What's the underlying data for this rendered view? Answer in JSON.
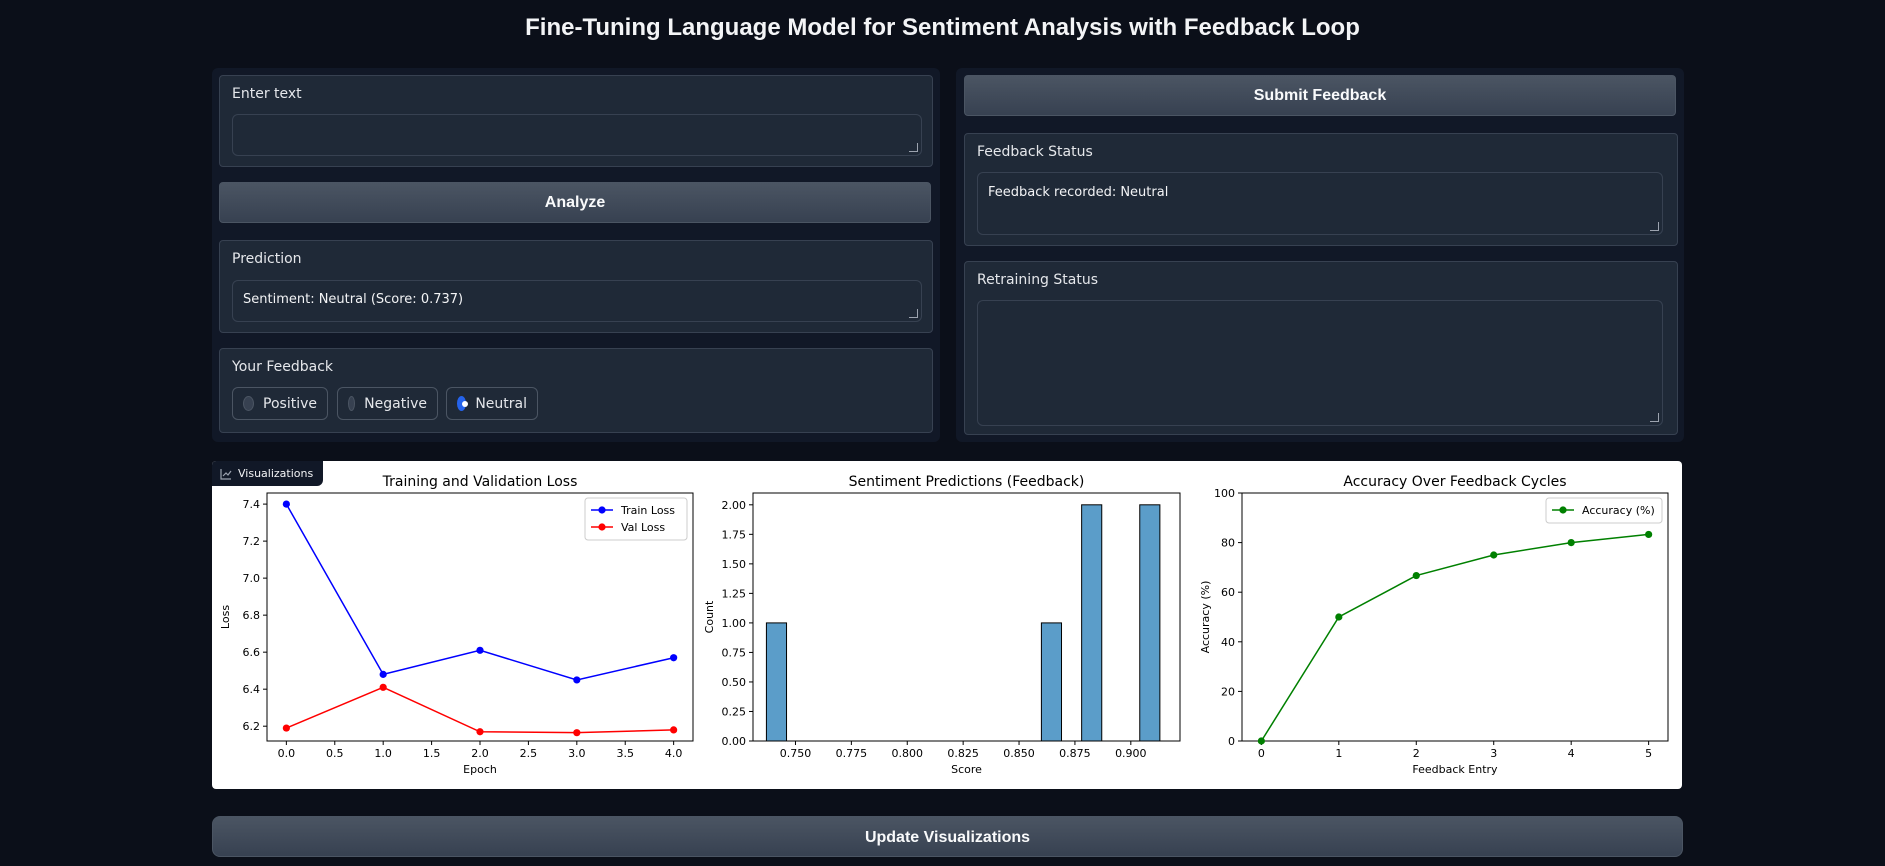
{
  "app": {
    "title": "Fine-Tuning Language Model for Sentiment Analysis with Feedback Loop"
  },
  "left": {
    "input_label": "Enter text",
    "input_value": "",
    "analyze_label": "Analyze",
    "prediction_label": "Prediction",
    "prediction_value": "Sentiment: Neutral (Score: 0.737)",
    "feedback_label": "Your Feedback",
    "feedback_options": [
      "Positive",
      "Negative",
      "Neutral"
    ],
    "feedback_selected": "Neutral"
  },
  "right": {
    "submit_label": "Submit Feedback",
    "feedback_status_label": "Feedback Status",
    "feedback_status_value": "Feedback recorded: Neutral",
    "retraining_status_label": "Retraining Status",
    "retraining_status_value": ""
  },
  "visualizations": {
    "tag_label": "Visualizations",
    "tag_icon": "chart-icon",
    "update_label": "Update Visualizations"
  },
  "chart_data": [
    {
      "type": "line",
      "title": "Training and Validation Loss",
      "xlabel": "Epoch",
      "ylabel": "Loss",
      "x": [
        0,
        1,
        2,
        3,
        4
      ],
      "xlim": [
        -0.2,
        4.2
      ],
      "ylim": [
        6.12,
        7.46
      ],
      "xticks": [
        "0.0",
        "0.5",
        "1.0",
        "1.5",
        "2.0",
        "2.5",
        "3.0",
        "3.5",
        "4.0"
      ],
      "yticks": [
        "6.2",
        "6.4",
        "6.6",
        "6.8",
        "7.0",
        "7.2",
        "7.4"
      ],
      "legend": "top-right",
      "series": [
        {
          "name": "Train Loss",
          "color": "#0000ff",
          "values": [
            7.4,
            6.48,
            6.61,
            6.45,
            6.57
          ]
        },
        {
          "name": "Val Loss",
          "color": "#ff0000",
          "values": [
            6.19,
            6.41,
            6.17,
            6.165,
            6.18
          ]
        }
      ]
    },
    {
      "type": "bar",
      "title": "Sentiment Predictions (Feedback)",
      "xlabel": "Score",
      "ylabel": "Count",
      "xlim": [
        0.731,
        0.922
      ],
      "ylim": [
        0,
        2.1
      ],
      "xticks": [
        "0.750",
        "0.775",
        "0.800",
        "0.825",
        "0.850",
        "0.875",
        "0.900"
      ],
      "yticks": [
        "0.00",
        "0.25",
        "0.50",
        "0.75",
        "1.00",
        "1.25",
        "1.50",
        "1.75",
        "2.00"
      ],
      "bar_color": "#5b9dc9",
      "bins": [
        {
          "start": 0.737,
          "end": 0.746,
          "count": 1
        },
        {
          "start": 0.86,
          "end": 0.869,
          "count": 1
        },
        {
          "start": 0.878,
          "end": 0.887,
          "count": 2
        },
        {
          "start": 0.904,
          "end": 0.913,
          "count": 2
        }
      ]
    },
    {
      "type": "line",
      "title": "Accuracy Over Feedback Cycles",
      "xlabel": "Feedback Entry",
      "ylabel": "Accuracy (%)",
      "x": [
        0,
        1,
        2,
        3,
        4,
        5
      ],
      "xlim": [
        -0.25,
        5.25
      ],
      "ylim": [
        0,
        100
      ],
      "xticks": [
        "0",
        "1",
        "2",
        "3",
        "4",
        "5"
      ],
      "yticks": [
        "0",
        "20",
        "40",
        "60",
        "80",
        "100"
      ],
      "legend": "top-right",
      "series": [
        {
          "name": "Accuracy (%)",
          "color": "#008000",
          "values": [
            0,
            50,
            66.7,
            75,
            80,
            83.3
          ]
        }
      ]
    }
  ]
}
